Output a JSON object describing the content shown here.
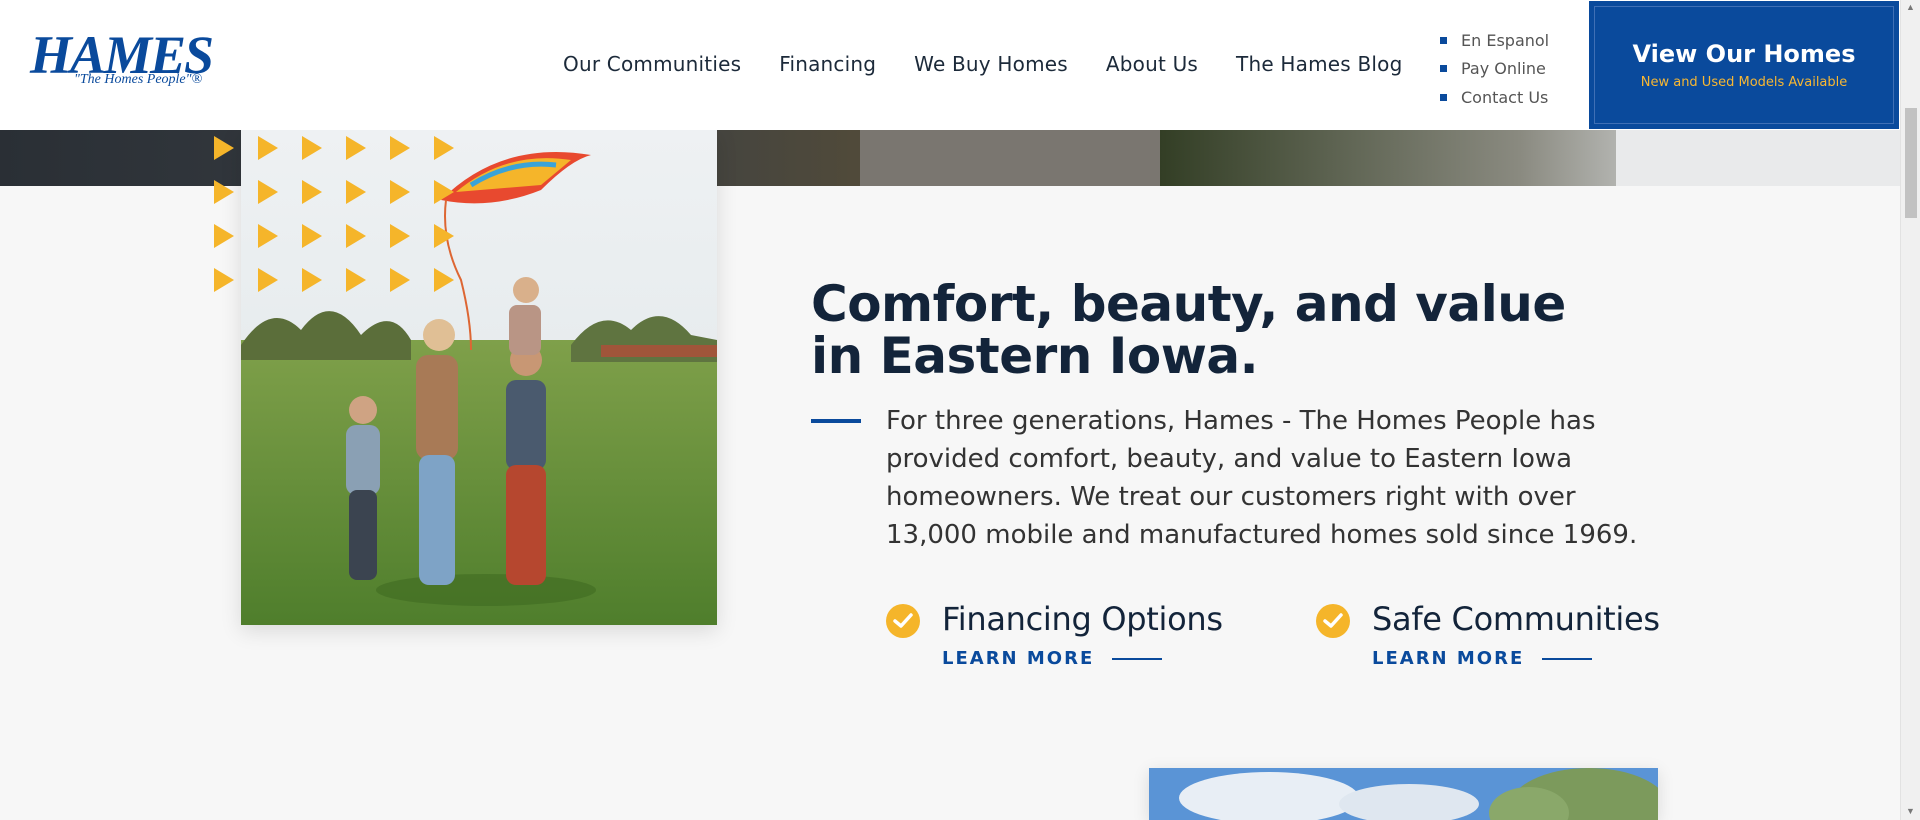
{
  "brand": {
    "logo_text": "HAMES",
    "tagline": "\"The Homes People\"®"
  },
  "nav": {
    "items": [
      {
        "label": "Our Communities"
      },
      {
        "label": "Financing"
      },
      {
        "label": "We Buy Homes"
      },
      {
        "label": "About Us"
      },
      {
        "label": "The Hames Blog"
      }
    ]
  },
  "utility": {
    "items": [
      {
        "label": "En Espanol"
      },
      {
        "label": "Pay Online"
      },
      {
        "label": "Contact Us"
      }
    ]
  },
  "cta": {
    "title": "View Our Homes",
    "subtitle": "New and Used Models Available"
  },
  "hero": {
    "heading": "Comfort, beauty, and value in Eastern Iowa.",
    "paragraph": "For three generations, Hames - The Homes People has provided comfort, beauty, and value to Eastern Iowa homeowners. We treat our customers right with over 13,000 mobile and manufactured homes sold since 1969."
  },
  "features": [
    {
      "title": "Financing Options",
      "link": "LEARN MORE"
    },
    {
      "title": "Safe Communities",
      "link": "LEARN MORE"
    }
  ],
  "colors": {
    "brand_blue": "#0a4a9c",
    "accent_yellow": "#f5b52a",
    "heading_navy": "#13243a"
  },
  "icons": {
    "feature_icon": "check-circle-icon",
    "decor": "triangle-pattern"
  }
}
